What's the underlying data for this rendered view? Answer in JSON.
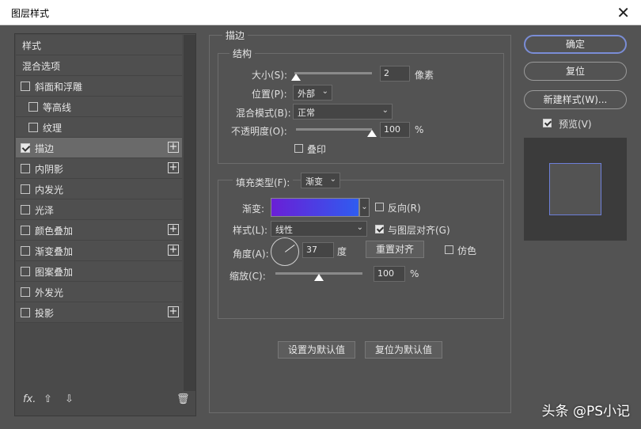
{
  "window": {
    "title": "图层样式",
    "close_glyph": "✕"
  },
  "left": {
    "items": [
      {
        "label": "样式",
        "type": "head"
      },
      {
        "label": "混合选项",
        "type": "head"
      },
      {
        "label": "斜面和浮雕",
        "checked": false,
        "plus": false
      },
      {
        "label": "等高线",
        "checked": false,
        "indent": true
      },
      {
        "label": "纹理",
        "checked": false,
        "indent": true
      },
      {
        "label": "描边",
        "checked": true,
        "plus": true,
        "selected": true
      },
      {
        "label": "内阴影",
        "checked": false,
        "plus": true
      },
      {
        "label": "内发光",
        "checked": false
      },
      {
        "label": "光泽",
        "checked": false
      },
      {
        "label": "颜色叠加",
        "checked": false,
        "plus": true
      },
      {
        "label": "渐变叠加",
        "checked": false,
        "plus": true
      },
      {
        "label": "图案叠加",
        "checked": false
      },
      {
        "label": "外发光",
        "checked": false
      },
      {
        "label": "投影",
        "checked": false,
        "plus": true
      }
    ],
    "footer": {
      "fx": "fx.",
      "up": "⇧",
      "down": "⇩",
      "trash": "🗑"
    }
  },
  "stroke": {
    "title": "描边",
    "structure": {
      "title": "结构",
      "size_label": "大小(S):",
      "size_value": "2",
      "size_unit": "像素",
      "size_slider": 0.02,
      "position_label": "位置(P):",
      "position_value": "外部",
      "blend_label": "混合模式(B):",
      "blend_value": "正常",
      "opacity_label": "不透明度(O):",
      "opacity_value": "100",
      "opacity_unit": "%",
      "opacity_slider": 1.0,
      "overprint_label": "叠印",
      "overprint_checked": false
    },
    "fill": {
      "type_label": "填充类型(F):",
      "type_value": "渐变",
      "gradient_label": "渐变:",
      "gradient_colors": [
        "#6a1fd6",
        "#2f5cf0"
      ],
      "reverse_label": "反向(R)",
      "reverse_checked": false,
      "style_label": "样式(L):",
      "style_value": "线性",
      "align_label": "与图层对齐(G)",
      "align_checked": true,
      "angle_label": "角度(A):",
      "angle_value": "37",
      "angle_unit": "度",
      "reset_align": "重置对齐",
      "dither_label": "仿色",
      "dither_checked": false,
      "scale_label": "缩放(C):",
      "scale_value": "100",
      "scale_unit": "%",
      "scale_slider": 0.5
    },
    "set_default": "设置为默认值",
    "reset_default": "复位为默认值"
  },
  "right": {
    "ok": "确定",
    "reset": "复位",
    "new_style": "新建样式(W)...",
    "preview_label": "预览(V)",
    "preview_checked": true,
    "preview_border_color": "#6d7fd8"
  },
  "watermark": "头条 @PS小记",
  "colors": {
    "dialog_bg": "#535353",
    "accent": "#7a8dd6"
  }
}
